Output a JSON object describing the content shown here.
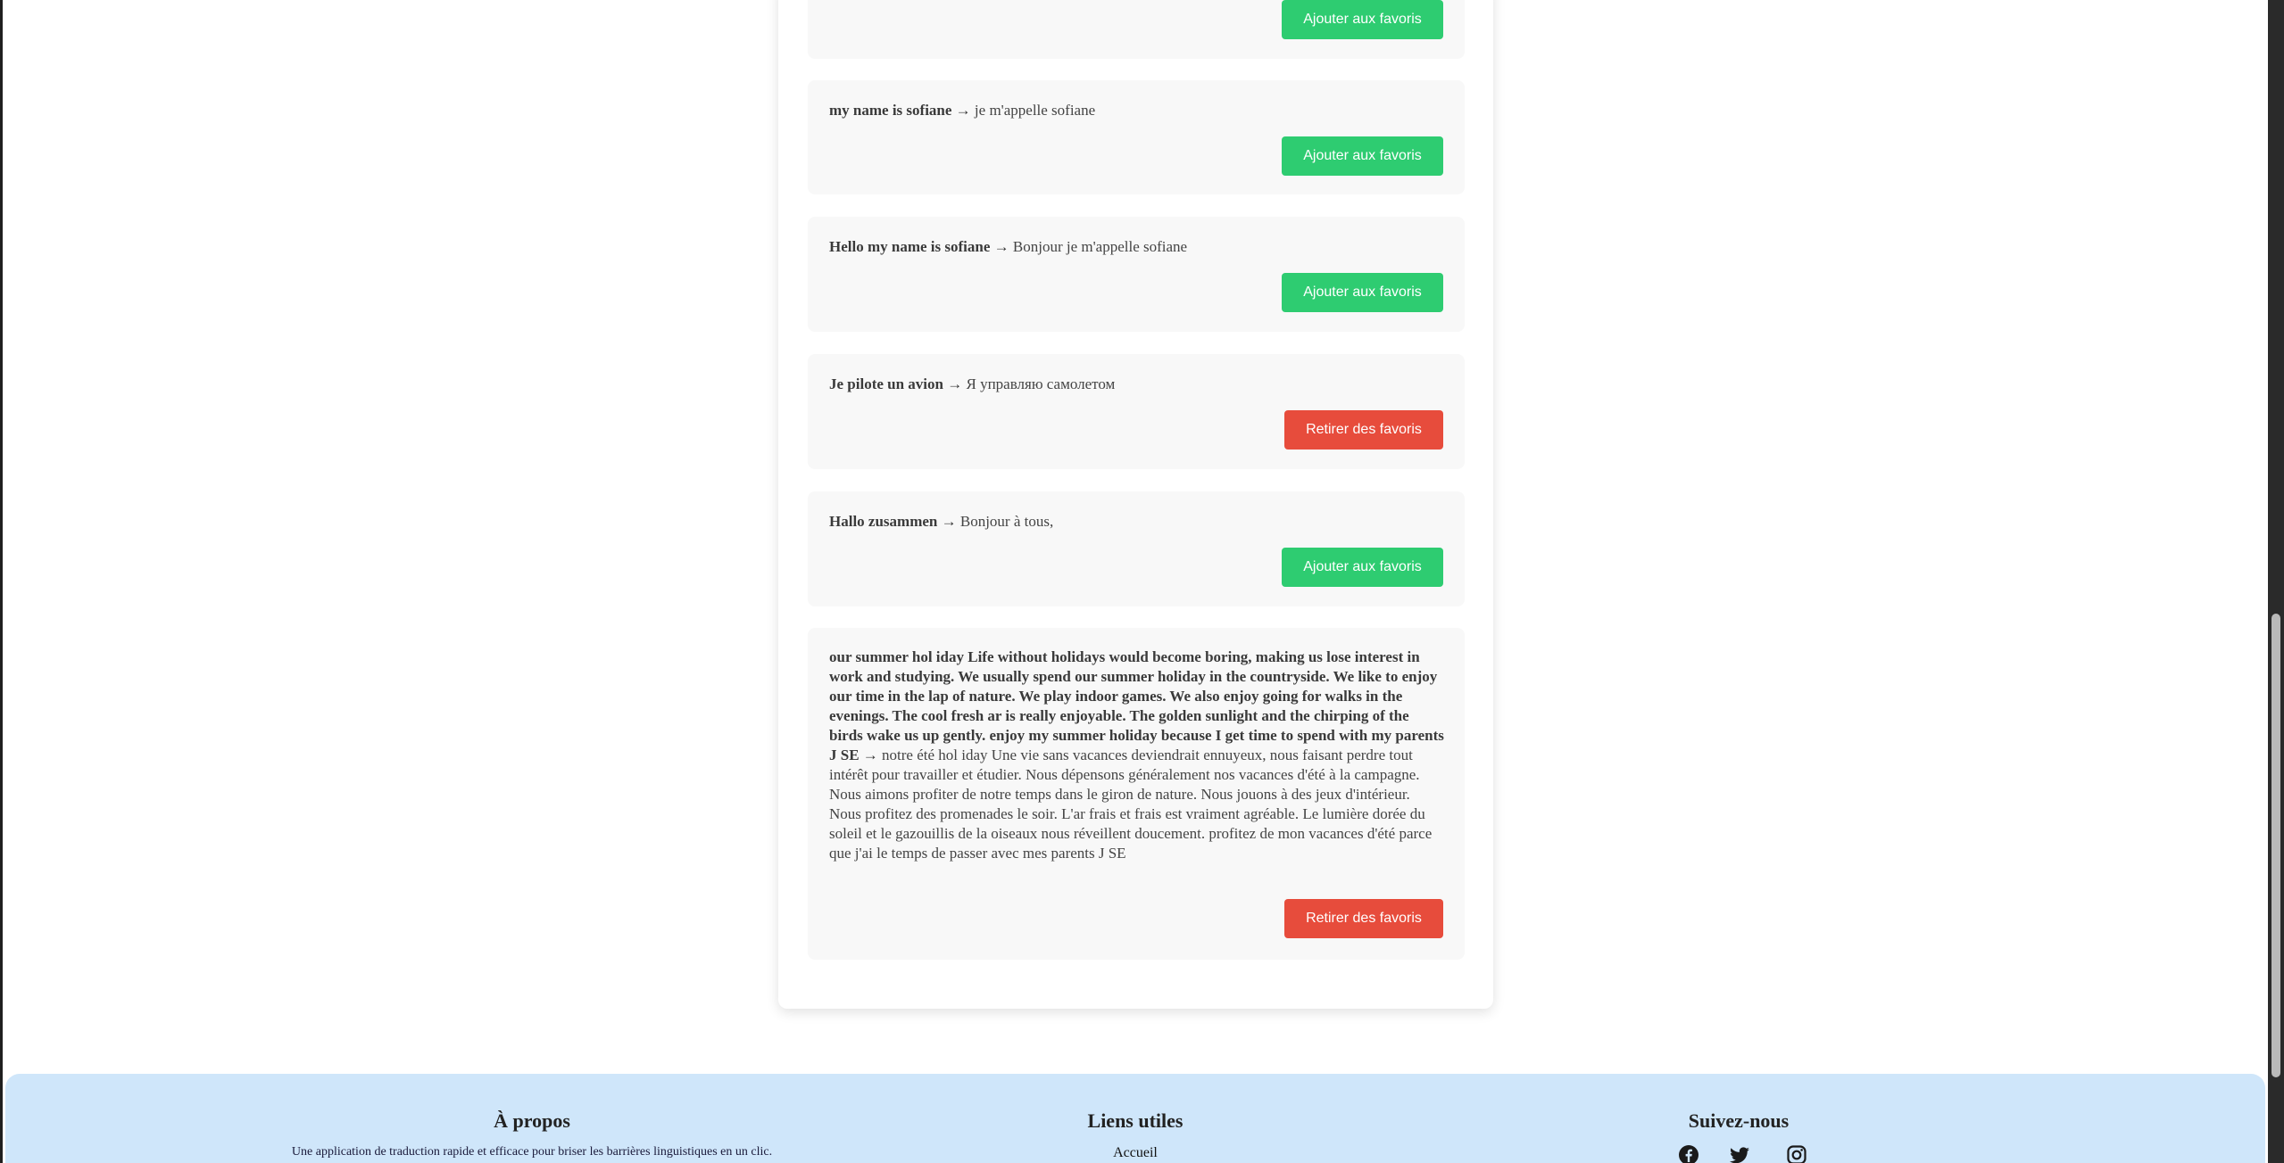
{
  "history": {
    "items": [
      {
        "source": "",
        "target": "",
        "button": "Ajouter aux favoris",
        "favorite": false
      },
      {
        "source": "my name is sofiane",
        "target": "je m'appelle sofiane",
        "button": "Ajouter aux favoris",
        "favorite": false
      },
      {
        "source": "Hello my name is sofiane",
        "target": "Bonjour je m'appelle sofiane",
        "button": "Ajouter aux favoris",
        "favorite": false
      },
      {
        "source": "Je pilote un avion",
        "target": "Я управляю самолетом",
        "button": "Retirer des favoris",
        "favorite": true
      },
      {
        "source": "Hallo zusammen",
        "target": "Bonjour à tous,",
        "button": "Ajouter aux favoris",
        "favorite": false
      },
      {
        "source": "our summer hol iday Life without holidays would become boring, making us lose interest in work and studying. We usually spend our summer holiday in the countryside. We like to enjoy our time in the lap of nature. We play indoor games. We also enjoy going for walks in the evenings. The cool fresh ar is really enjoyable. The golden sunlight and the chirping of the birds wake us up gently. enjoy my summer holiday because I get time to spend with my parents J SE",
        "target": "notre été hol iday Une vie sans vacances deviendrait ennuyeux, nous faisant perdre tout intérêt pour travailler et étudier. Nous dépensons généralement nos vacances d'été à la campagne. Nous aimons profiter de notre temps dans le giron de nature. Nous jouons à des jeux d'intérieur. Nous profitez des promenades le soir. L'ar frais et frais est vraiment agréable. Le lumière dorée du soleil et le gazouillis de la oiseaux nous réveillent doucement. profitez de mon vacances d'été parce que j'ai le temps de passer avec mes parents J SE",
        "button": "Retirer des favoris",
        "favorite": true
      }
    ],
    "arrow": "→"
  },
  "footer": {
    "about_title": "À propos",
    "about_text": "Une application de traduction rapide et efficace pour briser les barrières linguistiques en un clic.",
    "links_title": "Liens utiles",
    "links": [
      "Accueil"
    ],
    "follow_title": "Suivez-nous",
    "social_icons": [
      "facebook-icon",
      "twitter-icon",
      "instagram-icon"
    ]
  },
  "colors": {
    "add_button": "#2ecc71",
    "remove_button": "#e74c3c",
    "footer_bg": "#cfe6fa",
    "item_bg": "#f8f8f8"
  }
}
